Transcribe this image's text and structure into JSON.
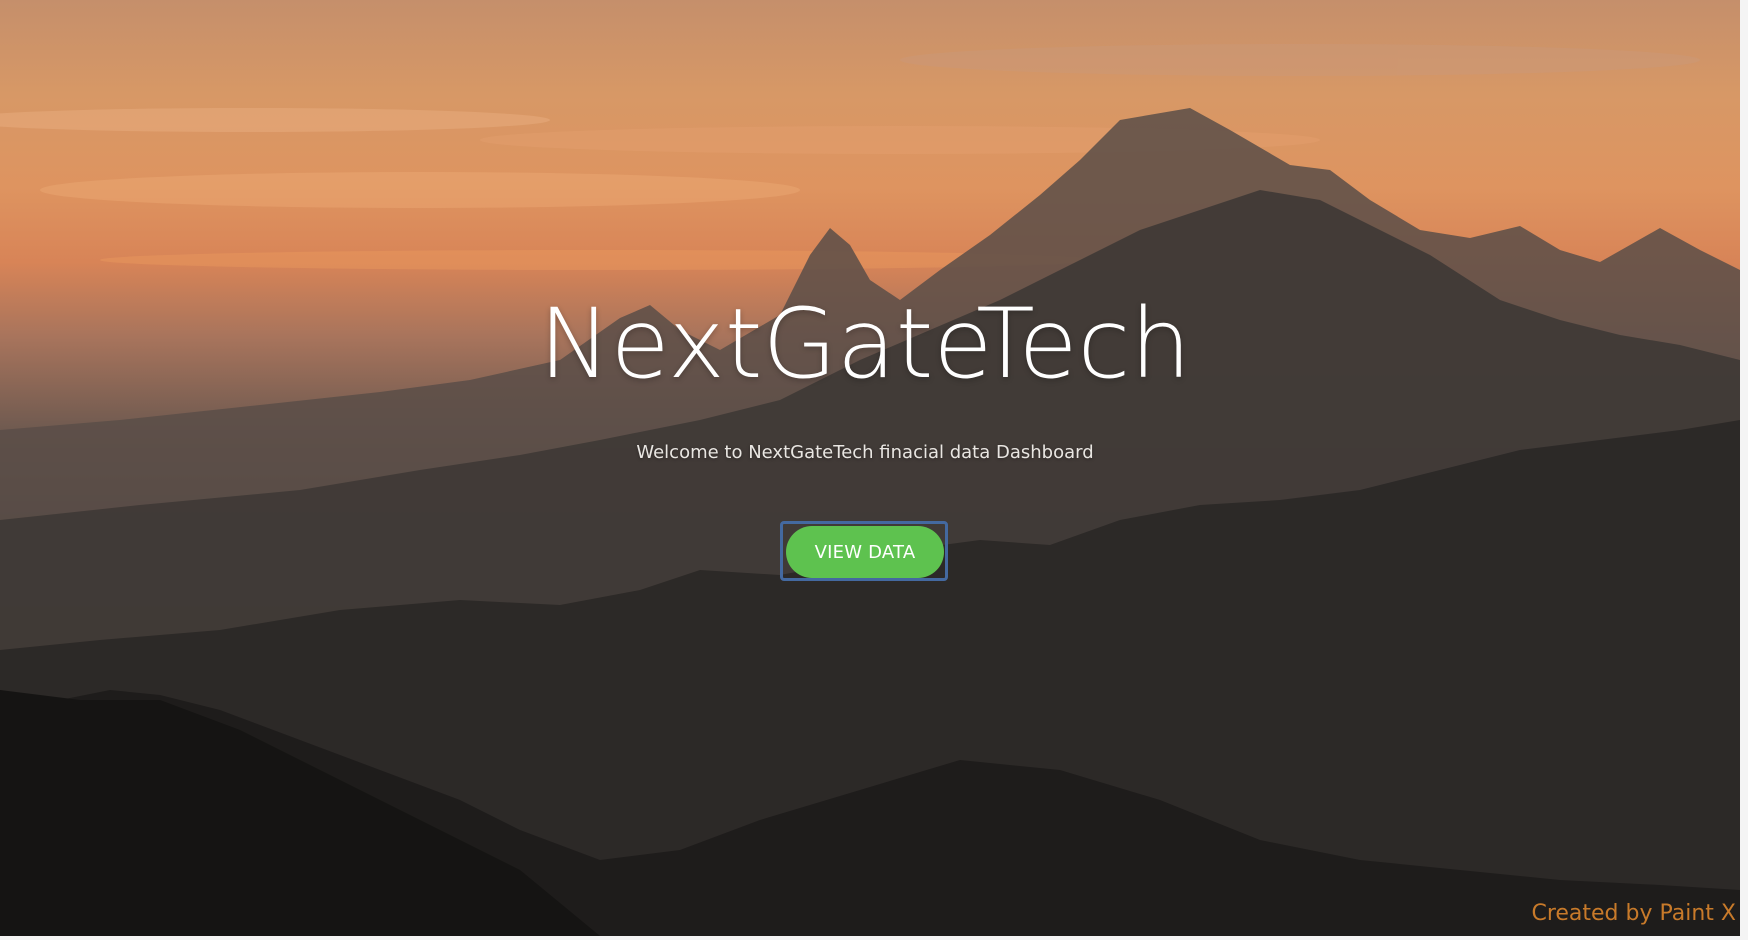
{
  "hero": {
    "title": "NextGateTech",
    "subtitle": "Welcome to NextGateTech finacial data Dashboard",
    "cta_label": "VIEW DATA"
  },
  "watermark": {
    "text": "Created by Paint X"
  },
  "colors": {
    "accent_button": "#5ec24f",
    "focus_ring": "#4469a0",
    "watermark": "#c87a2a",
    "sky_top": "#c58f6b",
    "sky_glow": "#de9460",
    "mountains_dark": "#1b1a19"
  },
  "icons": {
    "background": "mountain-sunset-photo"
  }
}
